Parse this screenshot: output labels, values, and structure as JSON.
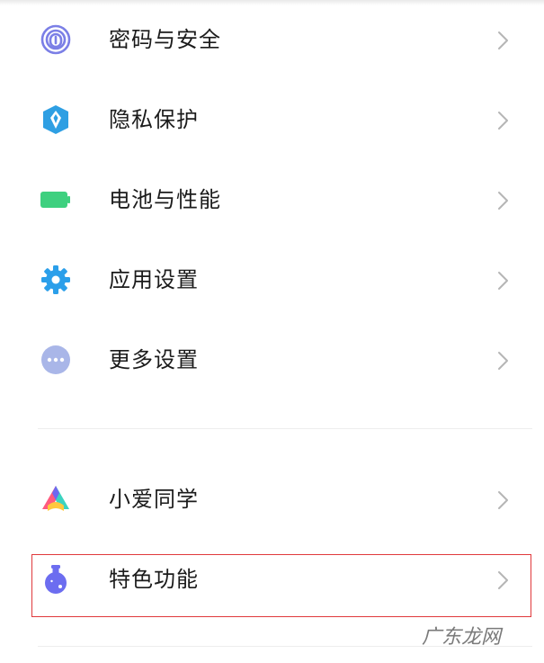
{
  "settings": {
    "items": [
      {
        "label": "密码与安全",
        "icon": "fingerprint-icon",
        "color": "#7b7fe6"
      },
      {
        "label": "隐私保护",
        "icon": "privacy-shield-icon",
        "color": "#2e9fe3"
      },
      {
        "label": "电池与性能",
        "icon": "battery-icon",
        "color": "#3ed07f"
      },
      {
        "label": "应用设置",
        "icon": "gear-icon",
        "color": "#2b9fea"
      },
      {
        "label": "更多设置",
        "icon": "more-dots-icon",
        "color": "#a9b6e8"
      },
      {
        "label": "小爱同学",
        "icon": "xiaoai-icon",
        "color": "#3bd3c0"
      },
      {
        "label": "特色功能",
        "icon": "flask-icon",
        "color": "#6c6df0"
      }
    ]
  },
  "highlight": {
    "target": "特色功能",
    "color": "#e0393c"
  },
  "watermark": {
    "text": "广东龙网"
  }
}
